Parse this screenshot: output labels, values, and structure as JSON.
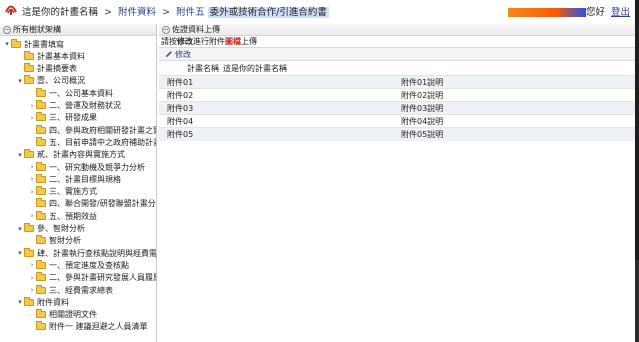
{
  "header": {
    "breadcrumb": {
      "root": "這是你的計畫名稱",
      "sep": ">",
      "level1": "附件資料",
      "level2": "附件五",
      "current": "委外或技術合作/引進合約書"
    },
    "user": {
      "greeting": "您好",
      "logout": "登出"
    },
    "colors": {
      "link": "#2a3f8f",
      "highlight": "#cfe0ff"
    }
  },
  "sidebar": {
    "title": "所有樹狀架構",
    "collapse_icon": "minus-circle-icon",
    "items": [
      {
        "label": "計畫書填寫",
        "arrow": "▾",
        "level": 0
      },
      {
        "label": "計畫基本資料",
        "arrow": "",
        "level": 1
      },
      {
        "label": "計畫摘要表",
        "arrow": "",
        "level": 1
      },
      {
        "label": "壹、公司概況",
        "arrow": "▾",
        "level": 1
      },
      {
        "label": "一、公司基本資料",
        "arrow": "",
        "level": 2
      },
      {
        "label": "二、營運及財務狀況",
        "arrow": "›",
        "level": 2
      },
      {
        "label": "三、研發成果",
        "arrow": "›",
        "level": 2
      },
      {
        "label": "四、參與政府相關研發計畫之實績",
        "arrow": "",
        "level": 2
      },
      {
        "label": "五、目前申請中之政府補助計畫",
        "arrow": "",
        "level": 2
      },
      {
        "label": "貳、計畫內容與實施方式",
        "arrow": "▾",
        "level": 1
      },
      {
        "label": "一、研究動機及競爭力分析",
        "arrow": "›",
        "level": 2
      },
      {
        "label": "二、計畫目標與規格",
        "arrow": "›",
        "level": 2
      },
      {
        "label": "三、實施方式",
        "arrow": "›",
        "level": 2
      },
      {
        "label": "四、聯合開發/研發聯盟計畫分工及",
        "arrow": "",
        "level": 2
      },
      {
        "label": "五、預期效益",
        "arrow": "›",
        "level": 2
      },
      {
        "label": "參、智財分析",
        "arrow": "▾",
        "level": 1
      },
      {
        "label": "智財分析",
        "arrow": "",
        "level": 2
      },
      {
        "label": "肆、計畫執行查核點說明與經費需求",
        "arrow": "▾",
        "level": 1
      },
      {
        "label": "一、預定進度及查核點",
        "arrow": "›",
        "level": 2
      },
      {
        "label": "二、參與計畫研究發展人員履歷表",
        "arrow": "›",
        "level": 2
      },
      {
        "label": "三、經費需求總表",
        "arrow": "›",
        "level": 2
      },
      {
        "label": "附件資料",
        "arrow": "▾",
        "level": 1
      },
      {
        "label": "相關證明文件",
        "arrow": "",
        "level": 2
      },
      {
        "label": "附件一 建議迴避之人員清單",
        "arrow": "",
        "level": 2
      }
    ]
  },
  "content": {
    "panel_title": "佐證資料上傳",
    "hint_prefix": "請按",
    "hint_edit": "修改",
    "hint_mid": "進行附件",
    "hint_em": "圖檔",
    "hint_suffix": "上傳",
    "edit_button": "修改",
    "project_label": "計畫名稱",
    "project_value": "這是你的計畫名稱",
    "attachments": [
      {
        "name": "附件01",
        "desc": "附件01說明"
      },
      {
        "name": "附件02",
        "desc": "附件02說明"
      },
      {
        "name": "附件03",
        "desc": "附件03說明"
      },
      {
        "name": "附件04",
        "desc": "附件04說明"
      },
      {
        "name": "附件05",
        "desc": "附件05說明"
      }
    ]
  }
}
